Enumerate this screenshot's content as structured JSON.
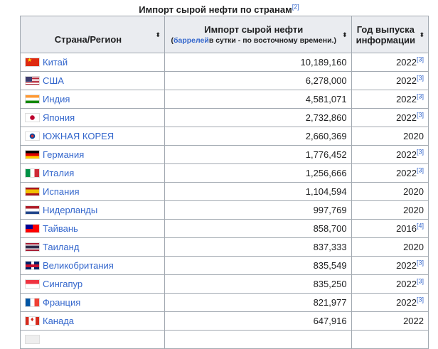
{
  "caption": {
    "text": "Импорт сырой нефти по странам",
    "ref": "[2]"
  },
  "headers": {
    "country": "Страна/Регион",
    "imports": "Импорт сырой нефти",
    "imports_sub_link": "баррелей",
    "imports_sub_rest": "в сутки - по восточному времени.)",
    "imports_sub_open": "(",
    "year_line1": "Год выпуска",
    "year_line2": "информации",
    "sort_icon": "⬍"
  },
  "rows": [
    {
      "flag": "f-cn",
      "country": "Китай",
      "imports": "10,189,160",
      "year": "2022",
      "ref": "[3]"
    },
    {
      "flag": "f-us",
      "country": "США",
      "imports": "6,278,000",
      "year": "2022",
      "ref": "[3]"
    },
    {
      "flag": "f-in",
      "country": "Индия",
      "imports": "4,581,071",
      "year": "2022",
      "ref": "[3]"
    },
    {
      "flag": "f-jp",
      "country": "Япония",
      "imports": "2,732,860",
      "year": "2022",
      "ref": "[3]"
    },
    {
      "flag": "f-kr",
      "country": "ЮЖНАЯ КОРЕЯ",
      "imports": "2,660,369",
      "year": "2020",
      "ref": ""
    },
    {
      "flag": "f-de",
      "country": "Германия",
      "imports": "1,776,452",
      "year": "2022",
      "ref": "[3]"
    },
    {
      "flag": "f-it",
      "country": "Италия",
      "imports": "1,256,666",
      "year": "2022",
      "ref": "[3]"
    },
    {
      "flag": "f-es",
      "country": "Испания",
      "imports": "1,104,594",
      "year": "2020",
      "ref": ""
    },
    {
      "flag": "f-nl",
      "country": "Нидерланды",
      "imports": "997,769",
      "year": "2020",
      "ref": ""
    },
    {
      "flag": "f-tw",
      "country": "Тайвань",
      "imports": "858,700",
      "year": "2016",
      "ref": "[4]"
    },
    {
      "flag": "f-th",
      "country": "Таиланд",
      "imports": "837,333",
      "year": "2020",
      "ref": ""
    },
    {
      "flag": "f-gb",
      "country": "Великобритания",
      "imports": "835,549",
      "year": "2022",
      "ref": "[3]"
    },
    {
      "flag": "f-sg",
      "country": "Сингапур",
      "imports": "835,250",
      "year": "2022",
      "ref": "[3]"
    },
    {
      "flag": "f-fr",
      "country": "Франция",
      "imports": "821,977",
      "year": "2022",
      "ref": "[3]"
    },
    {
      "flag": "f-ca",
      "country": "Канада",
      "imports": "647,916",
      "year": "2022",
      "ref": ""
    }
  ]
}
